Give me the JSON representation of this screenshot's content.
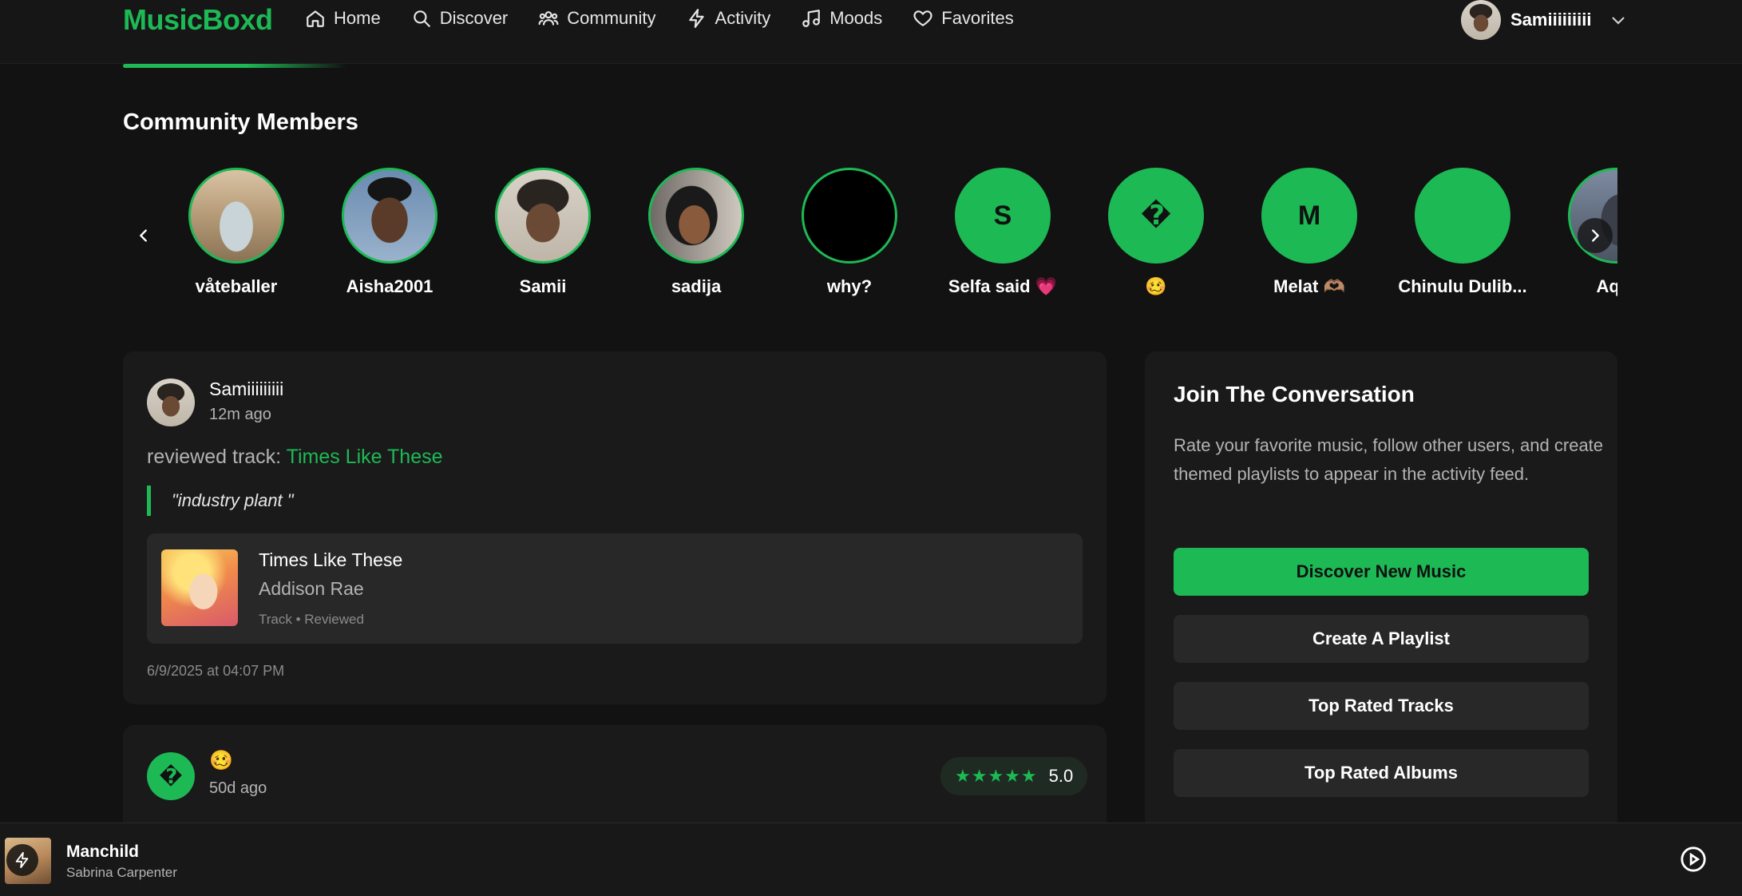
{
  "header": {
    "logo": "MusicBoxd",
    "nav": [
      {
        "label": "Home",
        "icon": "home-icon"
      },
      {
        "label": "Discover",
        "icon": "search-icon"
      },
      {
        "label": "Community",
        "icon": "users-icon"
      },
      {
        "label": "Activity",
        "icon": "bolt-icon"
      },
      {
        "label": "Moods",
        "icon": "music-note-icon"
      },
      {
        "label": "Favorites",
        "icon": "heart-icon"
      }
    ],
    "user": {
      "name": "Samiiiiiiiii"
    }
  },
  "community": {
    "title": "Community Members",
    "members": [
      {
        "name": "våteballer",
        "initial": ""
      },
      {
        "name": "Aisha2001",
        "initial": ""
      },
      {
        "name": "Samii",
        "initial": ""
      },
      {
        "name": "sadija",
        "initial": ""
      },
      {
        "name": "why?",
        "initial": ""
      },
      {
        "name": "Selfa said 💗",
        "initial": "S"
      },
      {
        "name": "🥴",
        "initial": "�"
      },
      {
        "name": "Melat 🫶🏽",
        "initial": "M"
      },
      {
        "name": "Chinulu Dulib...",
        "initial": ""
      },
      {
        "name": "Aqib",
        "initial": ""
      }
    ]
  },
  "feed": {
    "post1": {
      "user": "Samiiiiiiiii",
      "time": "12m ago",
      "action_prefix": "reviewed track: ",
      "action_link": "Times Like These",
      "quote": "\"industry plant \"",
      "track": {
        "title": "Times Like These",
        "artist": "Addison Rae",
        "meta": "Track • Reviewed"
      },
      "date": "6/9/2025 at 04:07 PM"
    },
    "post2": {
      "avatar_glyph": "�",
      "user": "🥴",
      "time": "50d ago",
      "stars": "★★★★★",
      "rating": "5.0"
    }
  },
  "sidebar": {
    "title": "Join The Conversation",
    "description": "Rate your favorite music, follow other users, and create themed playlists to appear in the activity feed.",
    "buttons": {
      "discover": "Discover New Music",
      "playlist": "Create A Playlist",
      "tracks": "Top Rated Tracks",
      "albums": "Top Rated Albums"
    }
  },
  "player": {
    "title": "Manchild",
    "artist": "Sabrina Carpenter"
  },
  "colors": {
    "accent": "#1db954",
    "background": "#121212",
    "card": "#1a1a1a"
  }
}
